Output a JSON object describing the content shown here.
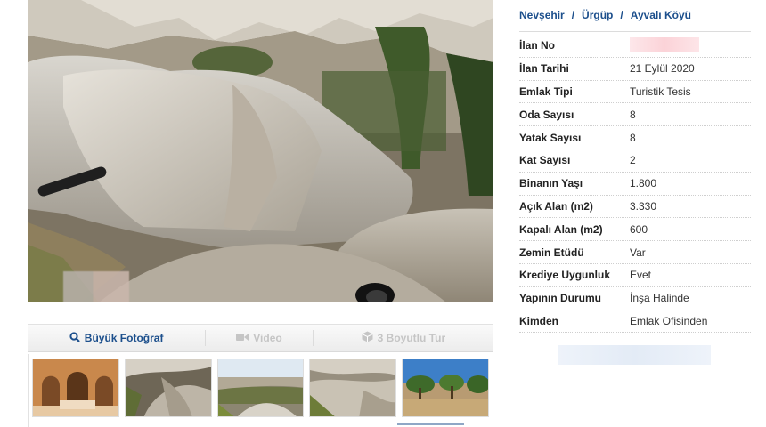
{
  "breadcrumb": {
    "items": [
      "Nevşehir",
      "Ürgüp",
      "Ayvalı Köyü"
    ],
    "separator": "/"
  },
  "details": {
    "rows": [
      {
        "label": "İlan No",
        "value": ""
      },
      {
        "label": "İlan Tarihi",
        "value": "21 Eylül 2020"
      },
      {
        "label": "Emlak Tipi",
        "value": "Turistik Tesis"
      },
      {
        "label": "Oda Sayısı",
        "value": "8"
      },
      {
        "label": "Yatak Sayısı",
        "value": "8"
      },
      {
        "label": "Kat Sayısı",
        "value": "2"
      },
      {
        "label": "Binanın Yaşı",
        "value": "1.800"
      },
      {
        "label": "Açık Alan (m2)",
        "value": "3.330"
      },
      {
        "label": "Kapalı Alan (m2)",
        "value": "600"
      },
      {
        "label": "Zemin Etüdü",
        "value": "Var"
      },
      {
        "label": "Krediye Uygunluk",
        "value": "Evet"
      },
      {
        "label": "Yapının Durumu",
        "value": "İnşa Halinde"
      },
      {
        "label": "Kimden",
        "value": "Emlak Ofisinden"
      }
    ]
  },
  "photo_tabs": {
    "large_photo": "Büyük Fotoğraf",
    "video": "Video",
    "tour_3d": "3 Boyutlu Tur"
  },
  "icons": {
    "large_photo": "search-icon",
    "video": "video-camera-icon",
    "tour_3d": "cube-icon"
  },
  "colors": {
    "link": "#1c4f8c",
    "disabled": "#c5c5c5"
  }
}
